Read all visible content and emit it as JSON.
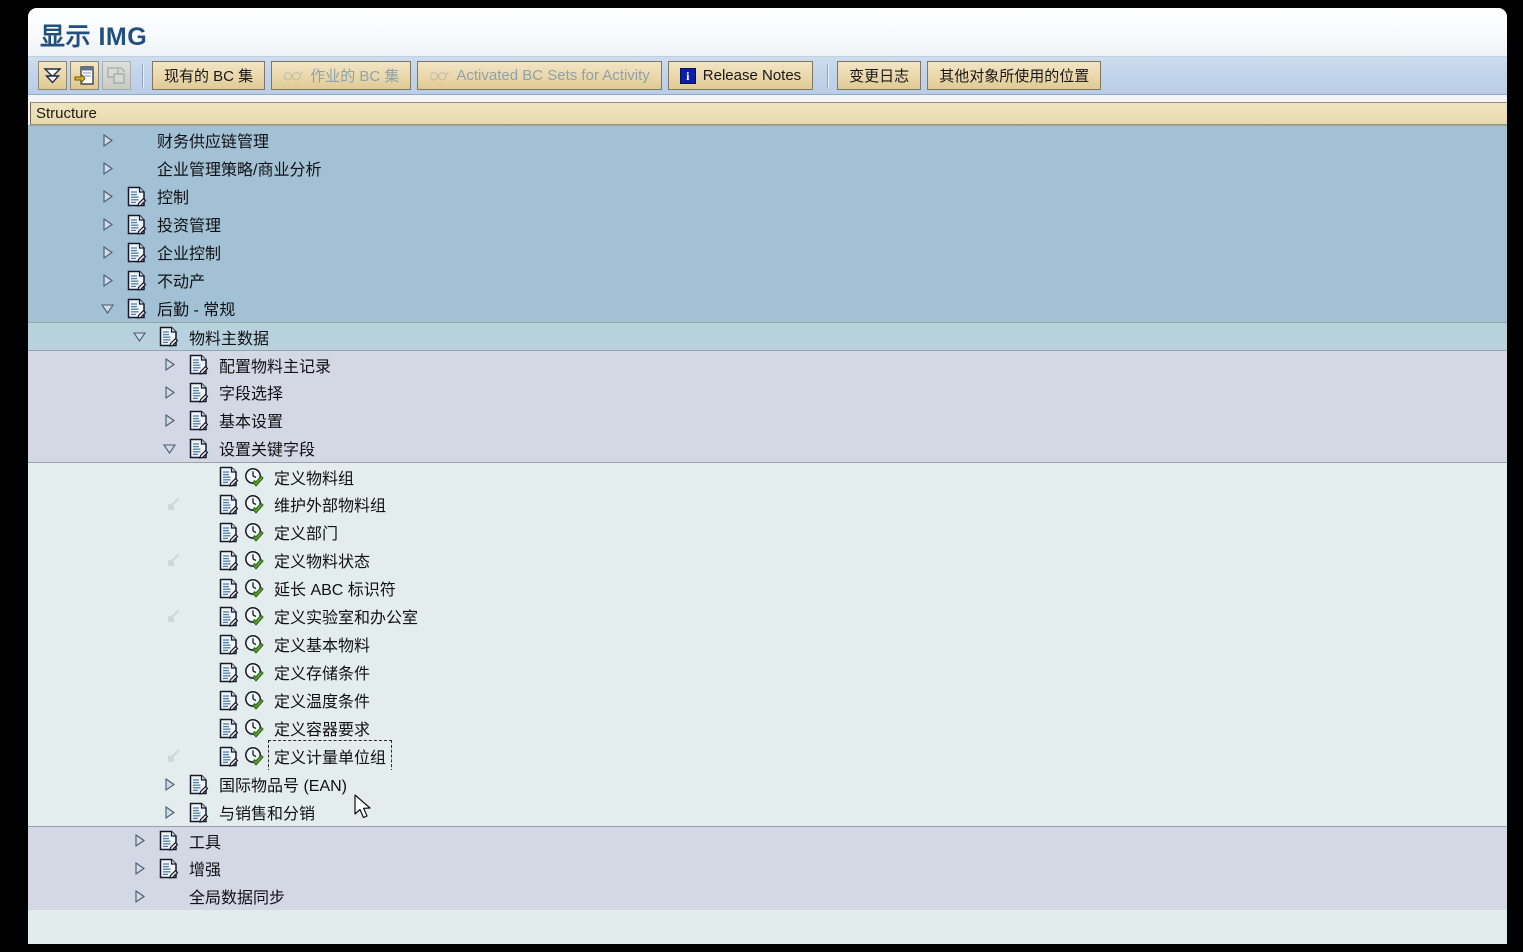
{
  "window": {
    "title": "显示 IMG"
  },
  "toolbar": {
    "icons": [
      {
        "name": "collapse-all-icon",
        "label": "",
        "disabled": false
      },
      {
        "name": "expand-subtree-icon",
        "label": "",
        "disabled": false
      },
      {
        "name": "copy-structure-icon",
        "label": "",
        "disabled": true
      }
    ],
    "buttons": [
      {
        "name": "existing-bc-sets-button",
        "label": "现有的 BC 集",
        "disabled": false,
        "icon": "none"
      },
      {
        "name": "activity-bc-sets-button",
        "label": "作业的 BC 集",
        "disabled": true,
        "icon": "glasses-icon"
      },
      {
        "name": "activated-bc-sets-for-activity-button",
        "label": "Activated BC Sets for Activity",
        "disabled": true,
        "icon": "glasses-icon"
      },
      {
        "name": "release-notes-button",
        "label": "Release Notes",
        "disabled": false,
        "icon": "info-icon"
      },
      {
        "name": "change-log-button",
        "label": "变更日志",
        "disabled": false,
        "icon": "none"
      },
      {
        "name": "where-used-button",
        "label": "其他对象所使用的位置",
        "disabled": false,
        "icon": "none"
      }
    ]
  },
  "structure": {
    "header": "Structure",
    "rows": [
      {
        "label": "财务供应链管理",
        "level": 0,
        "indent": 70,
        "twisty": "collapsed",
        "doc": false,
        "clock": false,
        "band": "lvl0",
        "connector": false,
        "focused": false
      },
      {
        "label": "企业管理策略/商业分析",
        "level": 0,
        "indent": 70,
        "twisty": "collapsed",
        "doc": false,
        "clock": false,
        "band": "lvl0",
        "connector": false,
        "focused": false
      },
      {
        "label": "控制",
        "level": 0,
        "indent": 70,
        "twisty": "collapsed",
        "doc": true,
        "clock": false,
        "band": "lvl0",
        "connector": false,
        "focused": false
      },
      {
        "label": "投资管理",
        "level": 0,
        "indent": 70,
        "twisty": "collapsed",
        "doc": true,
        "clock": false,
        "band": "lvl0",
        "connector": false,
        "focused": false
      },
      {
        "label": "企业控制",
        "level": 0,
        "indent": 70,
        "twisty": "collapsed",
        "doc": true,
        "clock": false,
        "band": "lvl0",
        "connector": false,
        "focused": false
      },
      {
        "label": "不动产",
        "level": 0,
        "indent": 70,
        "twisty": "collapsed",
        "doc": true,
        "clock": false,
        "band": "lvl0",
        "connector": false,
        "focused": false
      },
      {
        "label": "后勤 - 常规",
        "level": 0,
        "indent": 70,
        "twisty": "expanded",
        "doc": true,
        "clock": false,
        "band": "lvl0",
        "connector": false,
        "focused": false
      },
      {
        "label": "物料主数据",
        "level": 1,
        "indent": 102,
        "twisty": "expanded",
        "doc": true,
        "clock": false,
        "band": "lvl1",
        "connector": false,
        "focused": false
      },
      {
        "label": "配置物料主记录",
        "level": 2,
        "indent": 132,
        "twisty": "collapsed",
        "doc": true,
        "clock": false,
        "band": "lvl2",
        "connector": false,
        "focused": false
      },
      {
        "label": "字段选择",
        "level": 2,
        "indent": 132,
        "twisty": "collapsed",
        "doc": true,
        "clock": false,
        "band": "lvl2",
        "connector": false,
        "focused": false
      },
      {
        "label": "基本设置",
        "level": 2,
        "indent": 132,
        "twisty": "collapsed",
        "doc": true,
        "clock": false,
        "band": "lvl2",
        "connector": false,
        "focused": false
      },
      {
        "label": "设置关键字段",
        "level": 2,
        "indent": 132,
        "twisty": "expanded",
        "doc": true,
        "clock": false,
        "band": "lvl2",
        "connector": false,
        "focused": false
      },
      {
        "label": "定义物料组",
        "level": 3,
        "indent": 162,
        "twisty": "none",
        "doc": true,
        "clock": true,
        "band": "lvl3",
        "connector": false,
        "focused": false
      },
      {
        "label": "维护外部物料组",
        "level": 3,
        "indent": 162,
        "twisty": "none",
        "doc": true,
        "clock": true,
        "band": "lvl3",
        "connector": true,
        "focused": false
      },
      {
        "label": "定义部门",
        "level": 3,
        "indent": 162,
        "twisty": "none",
        "doc": true,
        "clock": true,
        "band": "lvl3",
        "connector": false,
        "focused": false
      },
      {
        "label": "定义物料状态",
        "level": 3,
        "indent": 162,
        "twisty": "none",
        "doc": true,
        "clock": true,
        "band": "lvl3",
        "connector": true,
        "focused": false
      },
      {
        "label": "延长 ABC 标识符",
        "level": 3,
        "indent": 162,
        "twisty": "none",
        "doc": true,
        "clock": true,
        "band": "lvl3",
        "connector": false,
        "focused": false
      },
      {
        "label": "定义实验室和办公室",
        "level": 3,
        "indent": 162,
        "twisty": "none",
        "doc": true,
        "clock": true,
        "band": "lvl3",
        "connector": true,
        "focused": false
      },
      {
        "label": "定义基本物料",
        "level": 3,
        "indent": 162,
        "twisty": "none",
        "doc": true,
        "clock": true,
        "band": "lvl3",
        "connector": false,
        "focused": false
      },
      {
        "label": "定义存储条件",
        "level": 3,
        "indent": 162,
        "twisty": "none",
        "doc": true,
        "clock": true,
        "band": "lvl3",
        "connector": false,
        "focused": false
      },
      {
        "label": "定义温度条件",
        "level": 3,
        "indent": 162,
        "twisty": "none",
        "doc": true,
        "clock": true,
        "band": "lvl3",
        "connector": false,
        "focused": false
      },
      {
        "label": "定义容器要求",
        "level": 3,
        "indent": 162,
        "twisty": "none",
        "doc": true,
        "clock": true,
        "band": "lvl3",
        "connector": false,
        "focused": false
      },
      {
        "label": "定义计量单位组",
        "level": 3,
        "indent": 162,
        "twisty": "none",
        "doc": true,
        "clock": true,
        "band": "lvl3",
        "connector": true,
        "focused": true
      },
      {
        "label": "国际物品号 (EAN)",
        "level": 2,
        "indent": 132,
        "twisty": "collapsed",
        "doc": true,
        "clock": false,
        "band": "lvl3",
        "connector": false,
        "focused": false
      },
      {
        "label": "与销售和分销",
        "level": 2,
        "indent": 132,
        "twisty": "collapsed",
        "doc": true,
        "clock": false,
        "band": "lvl3",
        "connector": false,
        "focused": false
      },
      {
        "label": "工具",
        "level": 1,
        "indent": 102,
        "twisty": "collapsed",
        "doc": true,
        "clock": false,
        "band": "lvl2",
        "connector": false,
        "focused": false
      },
      {
        "label": "增强",
        "level": 1,
        "indent": 102,
        "twisty": "collapsed",
        "doc": true,
        "clock": false,
        "band": "lvl2",
        "connector": false,
        "focused": false
      },
      {
        "label": "全局数据同步",
        "level": 1,
        "indent": 102,
        "twisty": "collapsed",
        "doc": false,
        "clock": false,
        "band": "lvl2",
        "connector": false,
        "focused": false
      }
    ]
  },
  "colors": {
    "title_text": "#22507e",
    "toolbar_bg": "#c2d4ea",
    "button_face": "#e9d6a8",
    "level0_band": "#a2c1d4",
    "level1_band": "#b8d2dd",
    "level2_band": "#d3d8e4",
    "level3_band": "#e4eded",
    "header_band": "#e9d9ab"
  }
}
